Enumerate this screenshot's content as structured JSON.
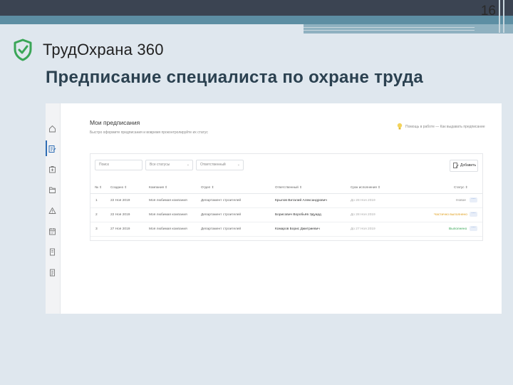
{
  "slide": {
    "number": "16",
    "logo_text": "ТрудОхрана 360",
    "title": "Предписание специалиста по охране труда"
  },
  "app": {
    "title": "Мои предписания",
    "subtitle": "Быстро оформите предписания и вовремя проконтролируйте их статус",
    "help_text": "Помощь в работе — Как выдавать предписание",
    "sidebar_icons": [
      "home-icon",
      "prescription-icon",
      "first-aid-icon",
      "folder-icon",
      "warning-icon",
      "calendar-icon",
      "document-icon",
      "checklist-icon"
    ],
    "filters": {
      "search_placeholder": "Поиск",
      "status_select": "Все статусы",
      "responsible_select": "Ответственный"
    },
    "add_button": "Добавить",
    "columns": [
      "№",
      "Создано",
      "Компания",
      "Отдел",
      "Ответственный",
      "Срок исполнения",
      "Статус"
    ],
    "rows": [
      {
        "num": "1",
        "created": "22 Ноя 2019",
        "company": "Моя любимая компания",
        "department": "Департамент строителей",
        "responsible": "Крылов Виталий Александрович",
        "deadline": "До 28 Ноя 2019",
        "status": "Новое"
      },
      {
        "num": "2",
        "created": "22 Ноя 2019",
        "company": "Моя любимая компания",
        "department": "Департамент строителей",
        "responsible": "Борисович Воробьёв Эдуард",
        "deadline": "До 28 Ноя 2019",
        "status": "Частично выполнено"
      },
      {
        "num": "3",
        "created": "27 Ноя 2019",
        "company": "Моя любимая компания",
        "department": "Департамент строителей",
        "responsible": "Комаров Борис Дмитриевич",
        "deadline": "До 27 Ноя 2019",
        "status": "Выполнено"
      }
    ],
    "colors": {
      "accent": "#2e6db4",
      "logo_green": "#3aa657",
      "status_new": "#888888",
      "status_partial": "#e0a020",
      "status_done": "#3aa657"
    }
  }
}
